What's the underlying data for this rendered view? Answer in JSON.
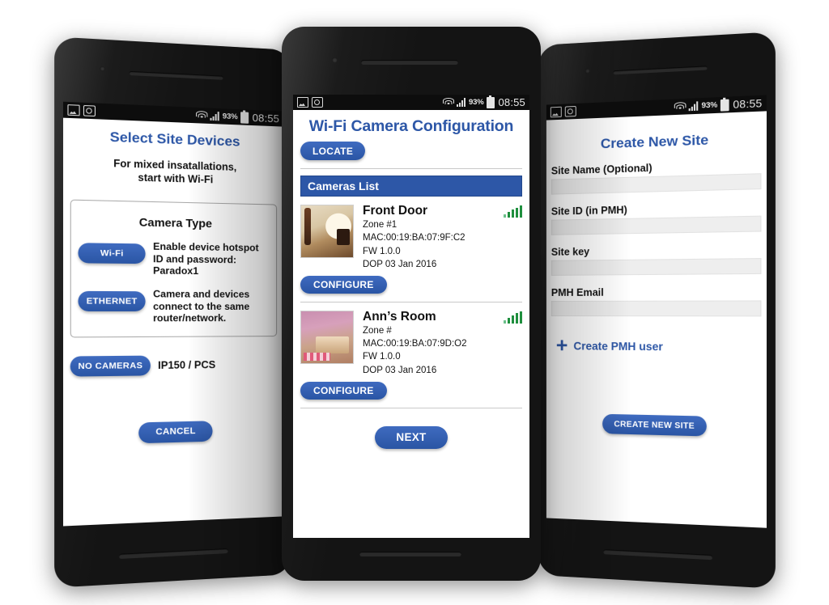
{
  "statusbar": {
    "icons": [
      "image-icon",
      "screenshot-icon"
    ],
    "wifi": "wifi-icon",
    "signal": "cellular-signal-icon",
    "battery_pct": "93%",
    "battery": "battery-icon",
    "time": "08:55"
  },
  "colors": {
    "brand_blue": "#2d57a7",
    "button_blue": "#3060b0",
    "signal_green": "#1f8f3e",
    "input_gray": "#eeeeee"
  },
  "left_phone": {
    "title": "Select Site Devices",
    "subtitle": "For mixed insatallations,\nstart with Wi-Fi",
    "card": {
      "heading": "Camera Type",
      "rows": [
        {
          "button": "Wi-Fi",
          "desc": "Enable device hotspot ID and password: Paradox1"
        },
        {
          "button": "ETHERNET",
          "desc": "Camera and devices connect to the same router/network."
        }
      ]
    },
    "no_cameras": {
      "button": "NO CAMERAS",
      "desc": "IP150 / PCS"
    },
    "cancel_label": "CANCEL"
  },
  "center_phone": {
    "title": "Wi-Fi Camera Configuration",
    "locate_label": "LOCATE",
    "list_header": "Cameras List",
    "cameras": [
      {
        "name": "Front Door",
        "zone": "Zone #1",
        "mac": "MAC:00:19:BA:07:9F:C2",
        "fw": "FW 1.0.0",
        "dop": "DOP 03 Jan 2016",
        "signal": "4-of-5-bars",
        "thumb": "living-room-thumbnail",
        "configure_label": "CONFIGURE"
      },
      {
        "name": "Ann’s Room",
        "zone": "Zone #",
        "mac": "MAC:00:19:BA:07:9D:O2",
        "fw": "FW 1.0.0",
        "dop": "DOP 03 Jan 2016",
        "signal": "4-of-5-bars",
        "thumb": "bedroom-thumbnail",
        "configure_label": "CONFIGURE"
      }
    ],
    "next_label": "NEXT"
  },
  "right_phone": {
    "title": "Create New Site",
    "fields": [
      {
        "label": "Site Name (Optional)",
        "value": "",
        "placeholder": ""
      },
      {
        "label": "Site ID (in PMH)",
        "value": "",
        "placeholder": ""
      },
      {
        "label": "Site key",
        "value": "",
        "placeholder": ""
      },
      {
        "label": "PMH Email",
        "value": "",
        "placeholder": ""
      }
    ],
    "create_user_label": "Create PMH user",
    "create_site_label": "CREATE NEW SITE"
  }
}
